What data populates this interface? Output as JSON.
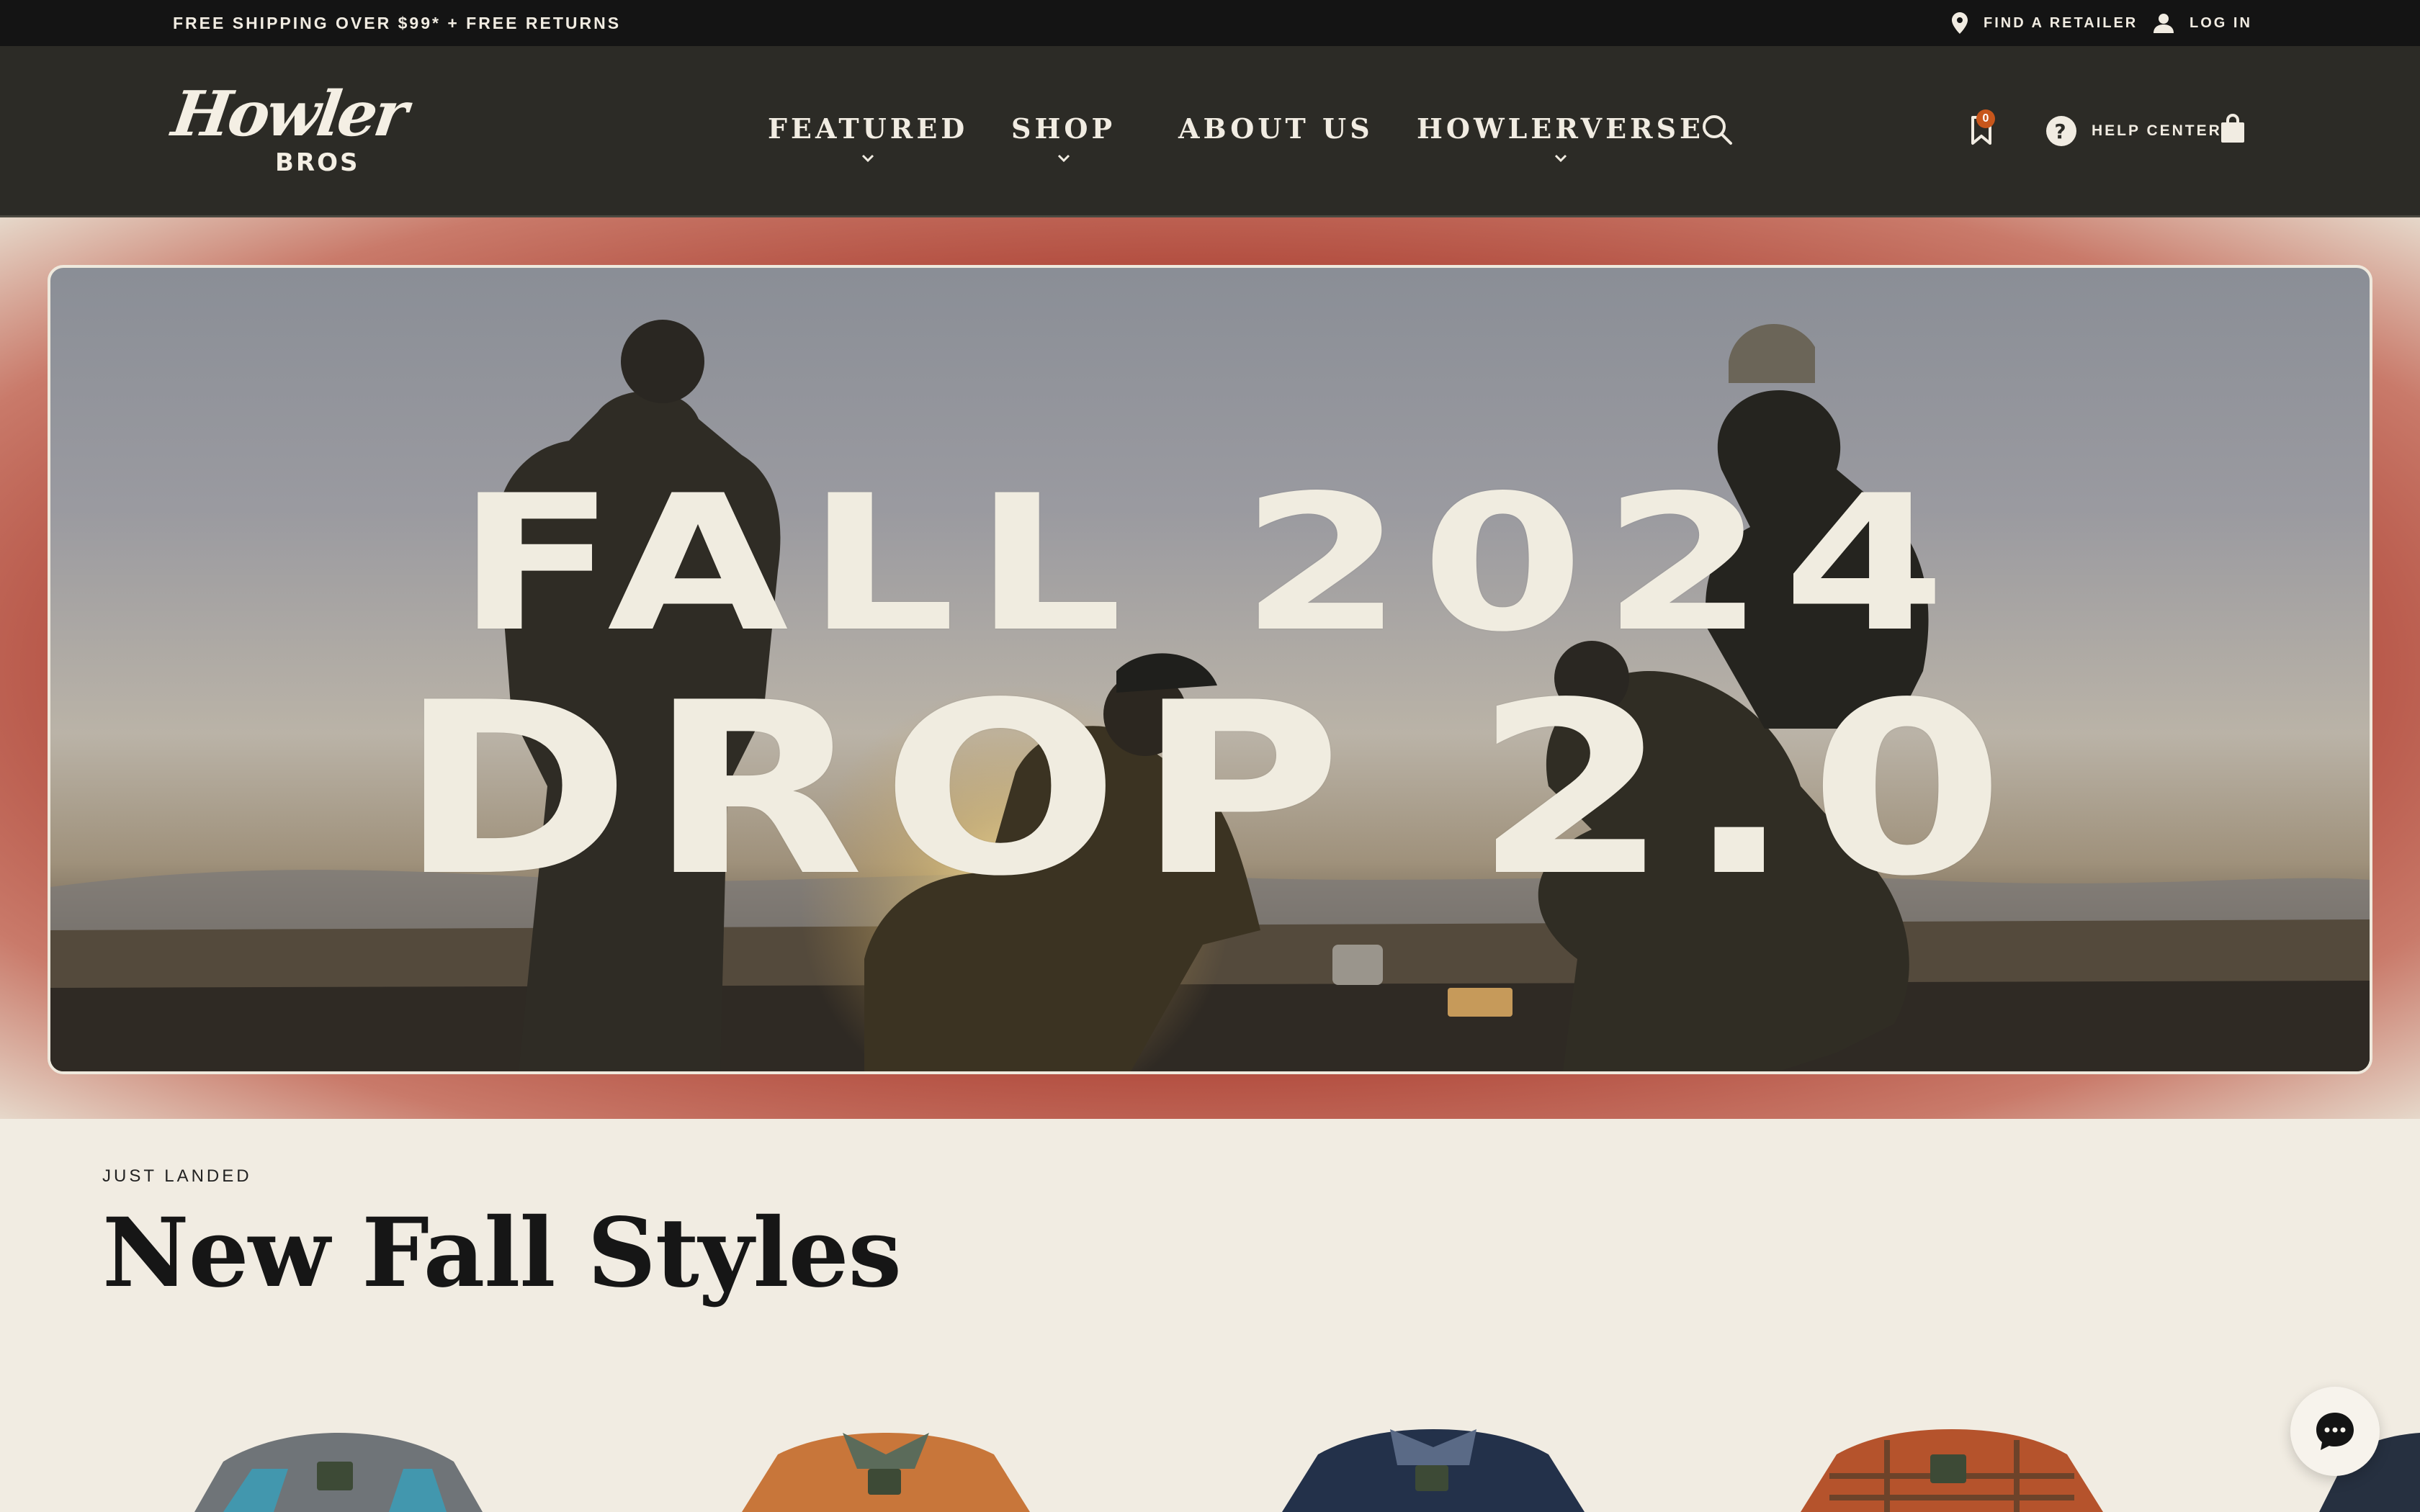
{
  "announcement": {
    "promo": "FREE SHIPPING OVER $99* + FREE RETURNS",
    "find_retailer": "FIND A RETAILER",
    "log_in": "LOG IN"
  },
  "header": {
    "logo_script": "Howler",
    "logo_sub": "BROS",
    "nav": [
      {
        "label": "FEATURED",
        "has_dropdown": true
      },
      {
        "label": "SHOP",
        "has_dropdown": true
      },
      {
        "label": "ABOUT US",
        "has_dropdown": false
      },
      {
        "label": "HOWLERVERSE",
        "has_dropdown": true
      }
    ],
    "wishlist_count": "0",
    "help_center": "HELP CENTER",
    "icons": [
      "search-icon",
      "bookmark-icon",
      "help-icon",
      "shopping-bag-icon",
      "location-pin-icon",
      "user-icon"
    ]
  },
  "hero": {
    "line1": "FALL 2024",
    "line2": "DROP 2.0"
  },
  "section": {
    "eyebrow": "JUST LANDED",
    "title": "New Fall Styles"
  },
  "products": [
    {
      "color": "#6f7478",
      "accent": "#2fa6c4"
    },
    {
      "color": "#c8763a",
      "accent": "#5b6b5a"
    },
    {
      "color": "#23314a",
      "accent": "#5a6a86"
    },
    {
      "color": "#b5532c",
      "accent": "#3e3a2a"
    },
    {
      "color": "#263040",
      "accent": "#111"
    }
  ],
  "colors": {
    "topbar": "#141414",
    "header": "#2c2b26",
    "hero_band": "#b14a3b",
    "page_bg": "#f1ece2",
    "badge": "#c7561b"
  }
}
